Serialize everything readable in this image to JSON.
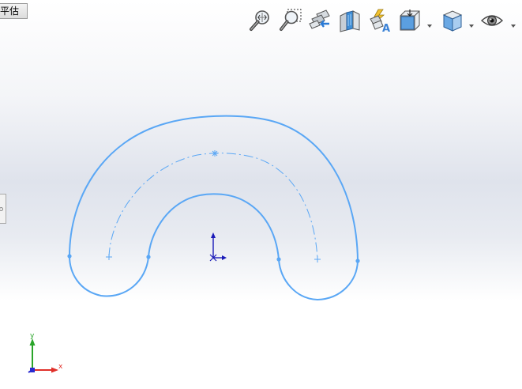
{
  "window": {
    "eval_tab_label": "平估"
  },
  "toolbar": {
    "items": [
      {
        "name": "zoom-to-fit",
        "icon": "zoom-to-fit-icon"
      },
      {
        "name": "zoom-to-area",
        "icon": "zoom-to-area-icon"
      },
      {
        "name": "previous-view",
        "icon": "previous-view-icon"
      },
      {
        "name": "section-view",
        "icon": "section-view-icon"
      },
      {
        "name": "dynamic-annotation-views",
        "icon": "dynamic-annotation-icon"
      },
      {
        "name": "view-orientation",
        "icon": "view-orientation-icon",
        "dropdown": true
      },
      {
        "name": "display-style",
        "icon": "display-style-icon",
        "dropdown": true
      },
      {
        "name": "hide-show-items",
        "icon": "eye-icon",
        "dropdown": true
      }
    ]
  },
  "sketch": {
    "stroke_color": "#5aa7f5",
    "centerline_color": "#5aa7f5"
  },
  "triad": {
    "x_label": "x",
    "y_label": "y",
    "x_color": "#e0302a",
    "y_color": "#2aa52a",
    "z_color": "#2a2ad0"
  }
}
